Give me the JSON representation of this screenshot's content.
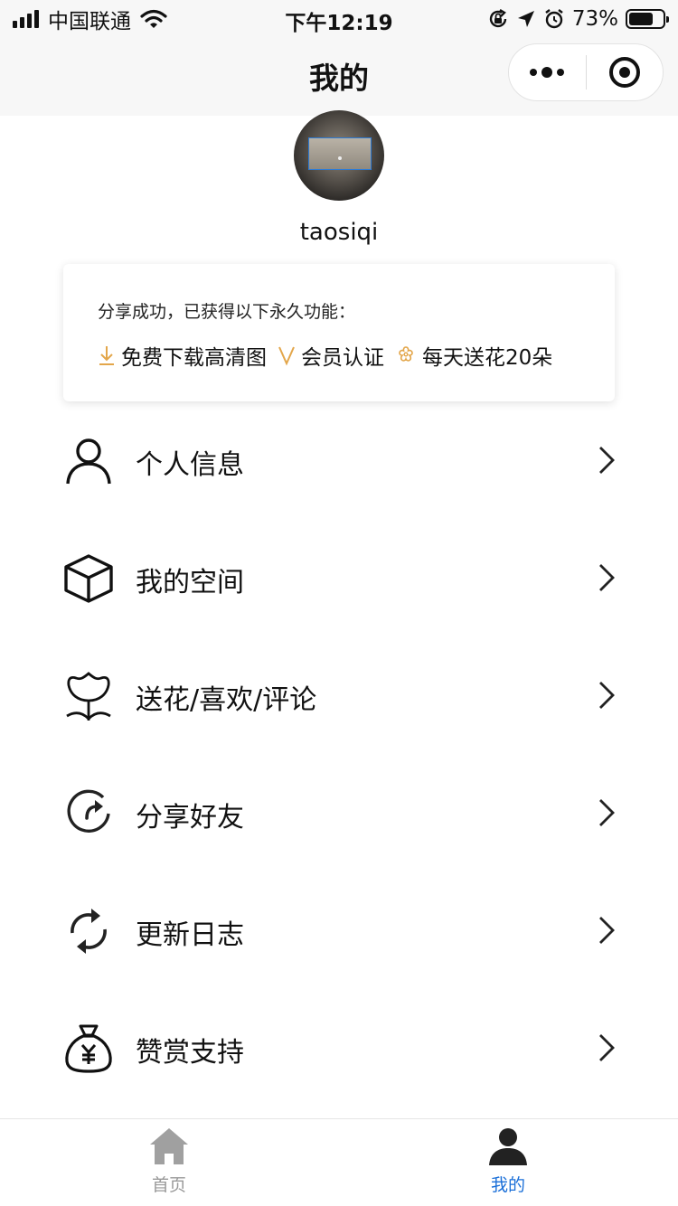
{
  "status_bar": {
    "carrier": "中国联通",
    "time": "下午12:19",
    "battery": "73%",
    "battery_level": 0.73,
    "icons": [
      "signal-icon",
      "wifi-icon",
      "rotation-lock-icon",
      "location-icon",
      "alarm-icon",
      "battery-icon"
    ]
  },
  "nav": {
    "title": "我的",
    "capsule_icons": [
      "more-dots-icon",
      "close-target-icon"
    ]
  },
  "profile": {
    "username": "taosiqi"
  },
  "share_card": {
    "text": "分享成功，已获得以下永久功能：",
    "perks": [
      {
        "icon": "download-icon",
        "label": "免费下载高清图"
      },
      {
        "icon": "vip-v-icon",
        "label": "会员认证"
      },
      {
        "icon": "flower-icon",
        "label": "每天送花20朵"
      }
    ],
    "accent_color": "#e3a64a"
  },
  "menu": [
    {
      "icon": "user-icon",
      "label": "个人信息"
    },
    {
      "icon": "box-icon",
      "label": "我的空间"
    },
    {
      "icon": "tulip-icon",
      "label": "送花/喜欢/评论"
    },
    {
      "icon": "share-refresh-icon",
      "label": "分享好友"
    },
    {
      "icon": "sync-icon",
      "label": "更新日志"
    },
    {
      "icon": "money-bag-icon",
      "label": "赞赏支持"
    }
  ],
  "tabbar": {
    "tabs": [
      {
        "icon": "home-icon",
        "label": "首页",
        "active": false
      },
      {
        "icon": "profile-icon",
        "label": "我的",
        "active": true
      }
    ],
    "active_color": "#1a6fd8",
    "inactive_color": "#999999"
  }
}
